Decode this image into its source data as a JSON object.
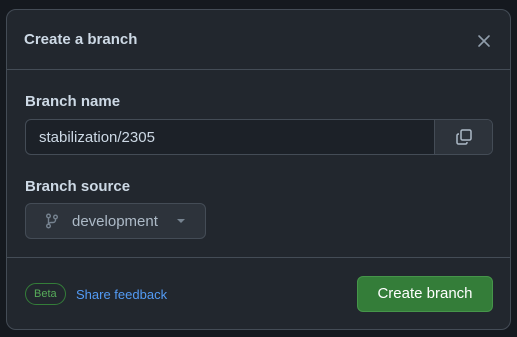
{
  "dialog": {
    "title": "Create a branch",
    "close_icon": "close-icon"
  },
  "branch_name": {
    "label": "Branch name",
    "value": "stabilization/2305",
    "copy_icon": "copy-icon"
  },
  "branch_source": {
    "label": "Branch source",
    "selected": "development",
    "icon": "git-branch-icon",
    "caret_icon": "caret-down-icon"
  },
  "footer": {
    "badge": "Beta",
    "feedback_link": "Share feedback",
    "create_button": "Create branch"
  },
  "colors": {
    "background": "#22272e",
    "border": "#444c56",
    "text": "#cdd9e5",
    "link": "#539bf5",
    "primary": "#347d39",
    "badge": "#57ab5a"
  }
}
